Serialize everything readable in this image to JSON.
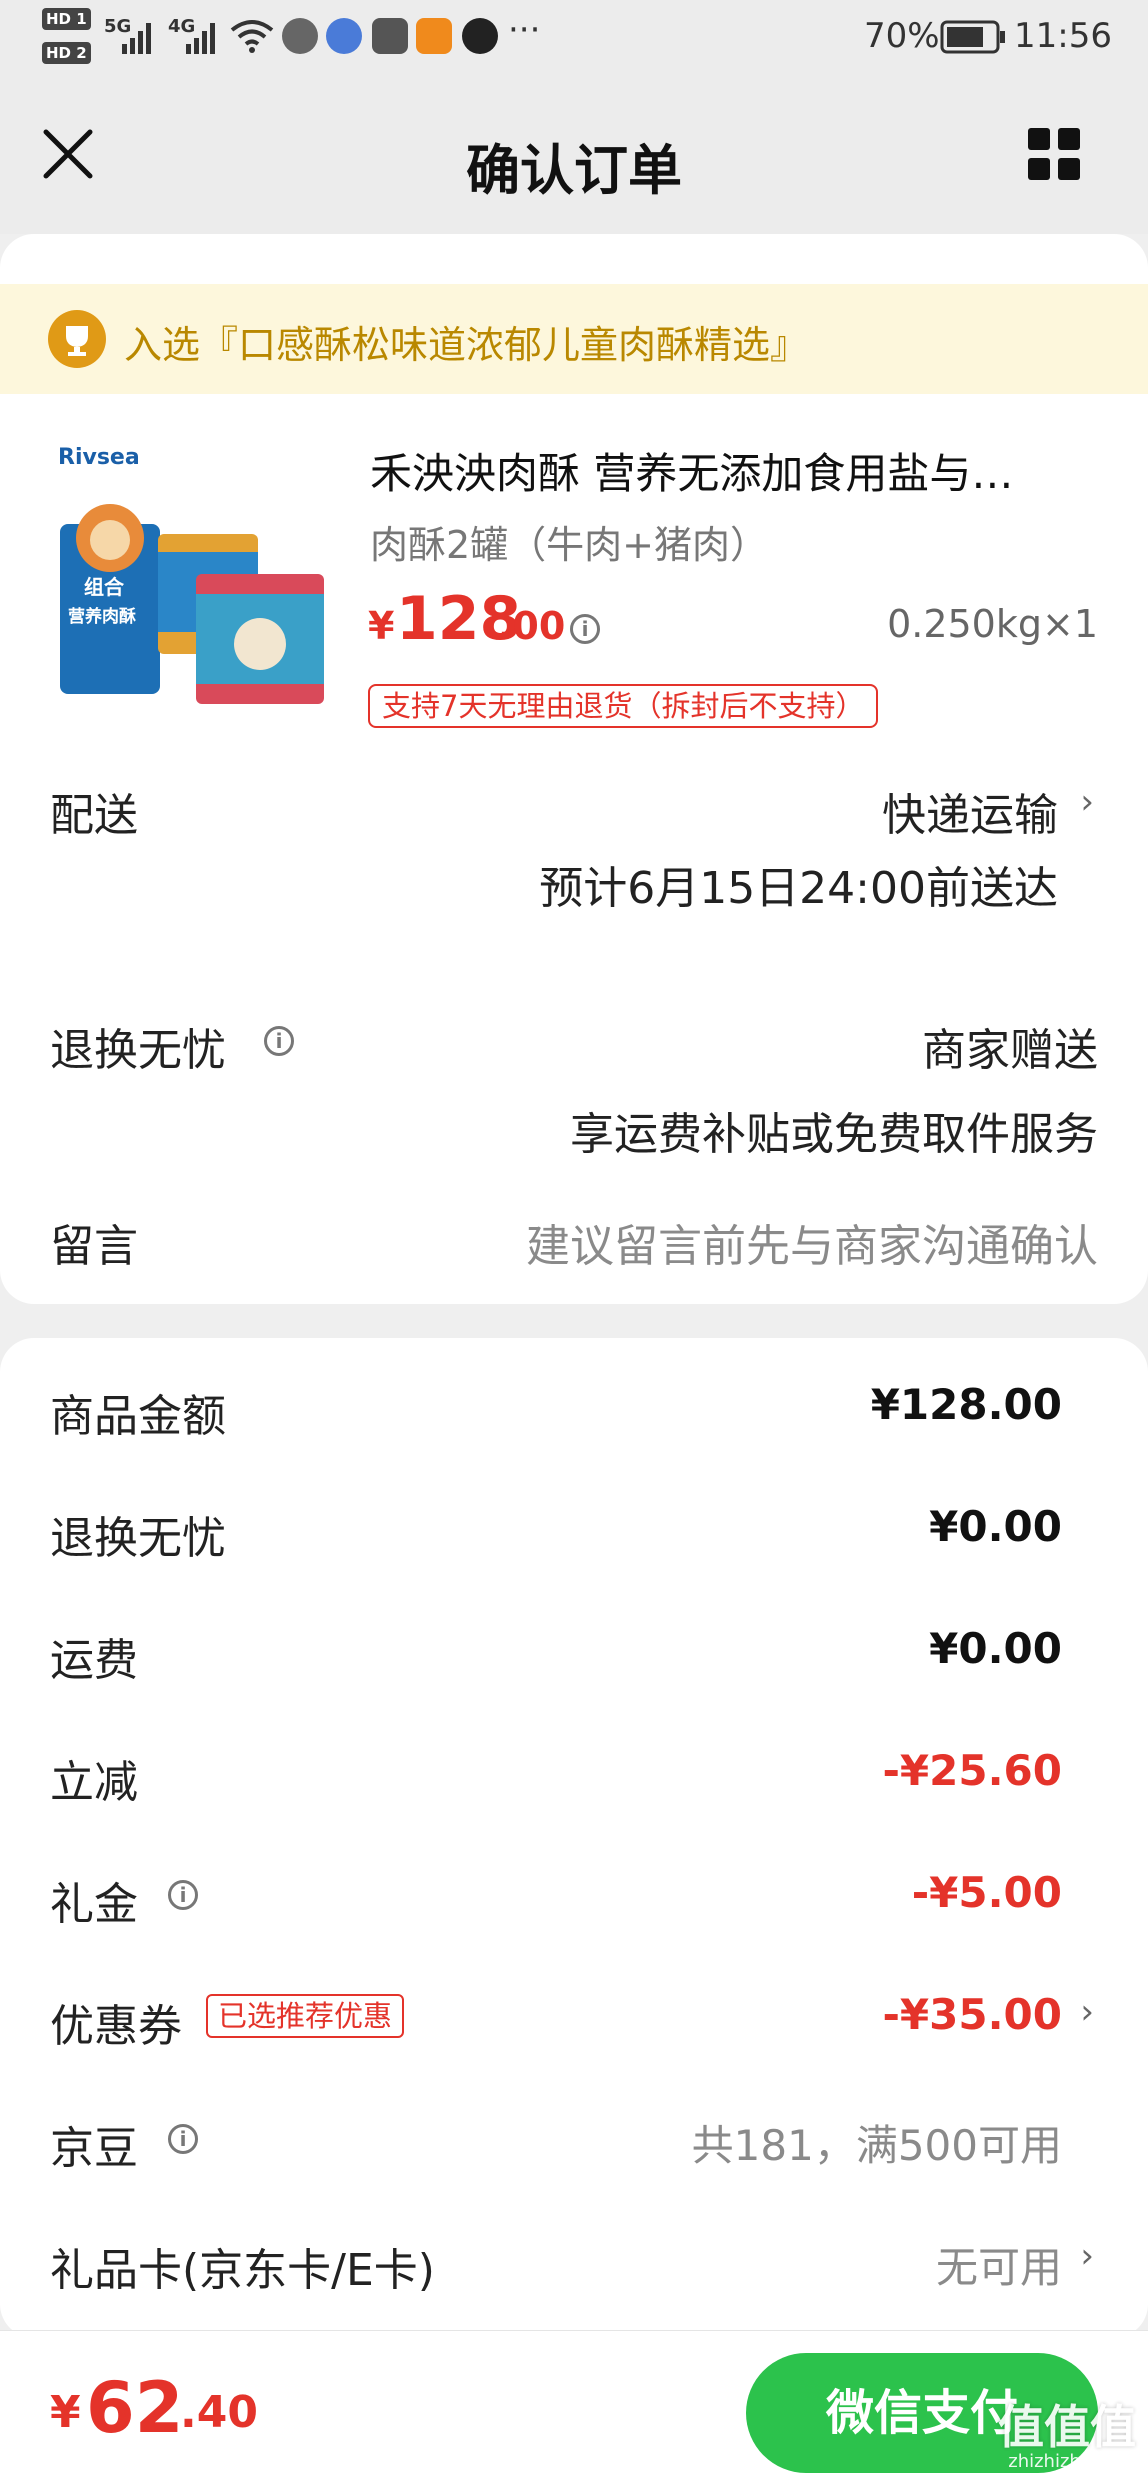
{
  "status_bar": {
    "hd1": "HD 1",
    "hd2": "HD 2",
    "net1": "5G",
    "net2": "4G",
    "more": "···",
    "battery": "70%",
    "time": "11:56"
  },
  "nav": {
    "title": "确认订单",
    "close_icon": "close-icon",
    "menu_icon": "grid-menu-icon"
  },
  "banner": {
    "text": "入选『口感酥松味道浓郁儿童肉酥精选』"
  },
  "product": {
    "title": "禾泱泱肉酥 营养无添加食用盐与…",
    "variant": "肉酥2罐（牛肉+猪肉）",
    "price_symbol": "¥",
    "price_int": "128",
    "price_dec": ".00",
    "qty": "0.250kg×1",
    "return_badge": "支持7天无理由退货（拆封后不支持）",
    "brand": "Rivsea",
    "pack_label": "组合",
    "pack_sub": "营养肉酥"
  },
  "delivery": {
    "label": "配送",
    "method": "快递运输",
    "eta": "预计6月15日24:00前送达"
  },
  "return_service": {
    "label": "退换无忧",
    "value": "商家赠送",
    "desc": "享运费补贴或免费取件服务"
  },
  "message": {
    "label": "留言",
    "placeholder": "建议留言前先与商家沟通确认"
  },
  "summary": {
    "items": [
      {
        "label": "商品金额",
        "value": "¥128.00"
      },
      {
        "label": "退换无忧",
        "value": "¥0.00"
      },
      {
        "label": "运费",
        "value": "¥0.00"
      },
      {
        "label": "立减",
        "value": "-¥25.60"
      },
      {
        "label": "礼金",
        "value": "-¥5.00"
      },
      {
        "label": "优惠券",
        "value": "-¥35.00",
        "tag": "已选推荐优惠"
      },
      {
        "label": "京豆",
        "value": "共181，满500可用"
      },
      {
        "label": "礼品卡(京东卡/E卡)",
        "value": "无可用"
      }
    ]
  },
  "bottom": {
    "total_symbol": "¥",
    "total_int": "62",
    "total_dec": ".40",
    "pay_label": "微信支付",
    "watermark": "值值值",
    "watermark_sub": "zhizhizhi.com"
  },
  "colors": {
    "accent_red": "#e4332a",
    "pay_green": "#2cc24c",
    "banner_gold": "#b98800"
  }
}
